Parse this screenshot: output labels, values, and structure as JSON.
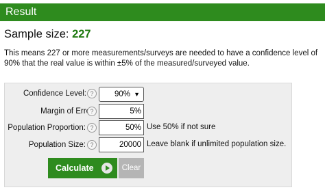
{
  "header": {
    "title": "Result"
  },
  "result": {
    "label": "Sample size:",
    "value": "227",
    "description": "This means 227 or more measurements/surveys are needed to have a confidence level of 90% that the real value is within ±5% of the measured/surveyed value."
  },
  "form": {
    "confidence": {
      "label": "Confidence Level:",
      "value": "90%"
    },
    "margin": {
      "label": "Margin of Error:",
      "value": "5%"
    },
    "proportion": {
      "label": "Population Proportion:",
      "value": "50%",
      "hint": "Use 50% if not sure"
    },
    "size": {
      "label": "Population Size:",
      "value": "20000",
      "hint": "Leave blank if unlimited population size."
    },
    "help_icon": "?",
    "calculate_label": "Calculate",
    "clear_label": "Clear"
  },
  "icons": {
    "help": "help-icon",
    "dropdown": "chevron-down-icon",
    "play": "play-circle-icon"
  },
  "colors": {
    "header_bg": "#2e8b1e",
    "result_value": "#1f7a10",
    "calculate_bg": "#2e8b1e",
    "clear_bg": "#b5b5b5"
  }
}
